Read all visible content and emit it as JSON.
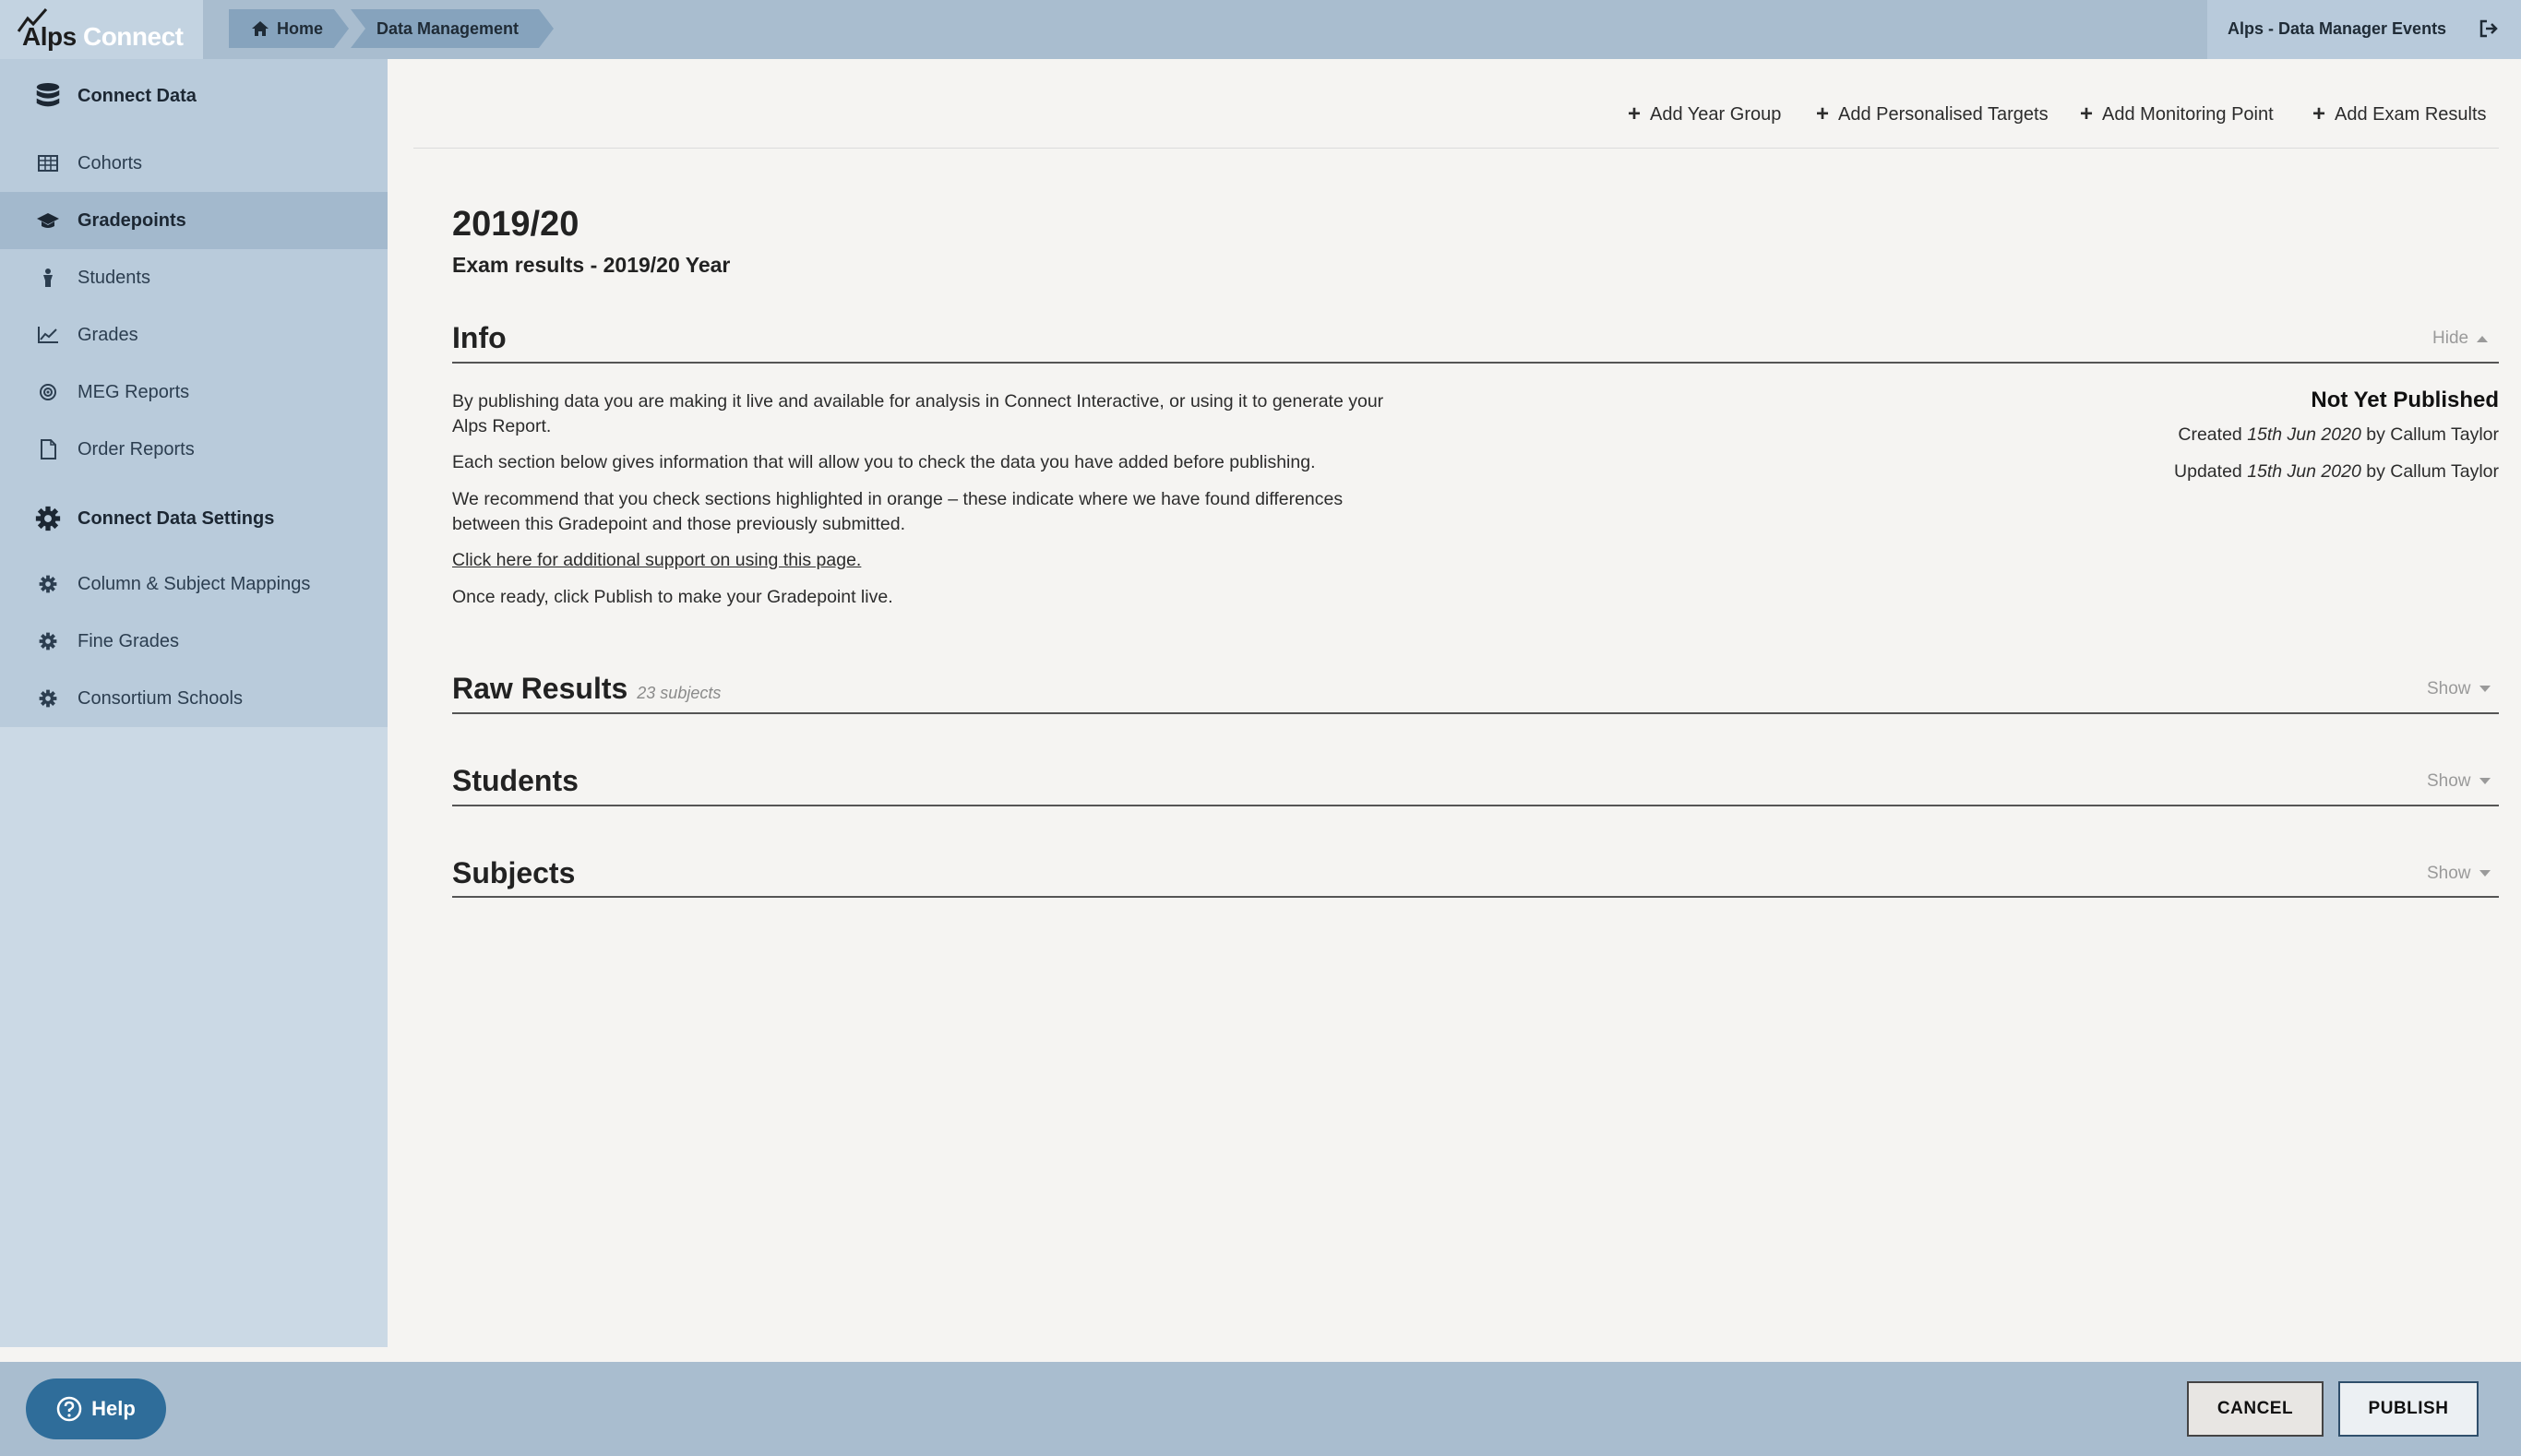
{
  "header": {
    "logo_primary": "Alps",
    "logo_secondary": "Connect",
    "breadcrumb": [
      "Home",
      "Data Management"
    ],
    "account_label": "Alps - Data Manager Events"
  },
  "sidebar": {
    "items": [
      {
        "label": "Connect Data",
        "icon": "database-icon"
      },
      {
        "label": "Cohorts",
        "icon": "table-icon"
      },
      {
        "label": "Gradepoints",
        "icon": "graduation-cap-icon",
        "active": true
      },
      {
        "label": "Students",
        "icon": "student-icon"
      },
      {
        "label": "Grades",
        "icon": "line-chart-icon"
      },
      {
        "label": "MEG Reports",
        "icon": "target-icon"
      },
      {
        "label": "Order Reports",
        "icon": "document-icon"
      },
      {
        "label": "Connect Data Settings",
        "icon": "gear-icon"
      },
      {
        "label": "Column & Subject Mappings",
        "icon": "gear-icon"
      },
      {
        "label": "Fine Grades",
        "icon": "gear-icon"
      },
      {
        "label": "Consortium Schools",
        "icon": "gear-icon"
      }
    ]
  },
  "toolbar": {
    "links": [
      "Add Year Group",
      "Add Personalised Targets",
      "Add Monitoring Point",
      "Add Exam Results"
    ]
  },
  "main": {
    "year": "2019/20",
    "subtitle": "Exam results - 2019/20 Year",
    "info": {
      "title": "Info",
      "toggle": "Hide",
      "paragraphs": [
        "By publishing data you are making it live and available for analysis in Connect Interactive, or using it to generate your Alps Report.",
        "Each section below gives information that will allow you to check the data you have added before publishing.",
        "We recommend that you check sections highlighted in orange – these indicate where we have found differences between this Gradepoint and those previously submitted."
      ],
      "support_link": "Click here for additional support on using this page.",
      "final_note": "Once ready, click Publish to make your Gradepoint live.",
      "status": "Not Yet Published",
      "created_prefix": "Created",
      "created_date": "15th Jun 2020",
      "created_by": "by Callum Taylor",
      "updated_prefix": "Updated",
      "updated_date": "15th Jun 2020",
      "updated_by": "by Callum Taylor"
    },
    "raw_results": {
      "title": "Raw Results",
      "count": "23 subjects",
      "toggle": "Show"
    },
    "students": {
      "title": "Students",
      "toggle": "Show"
    },
    "subjects": {
      "title": "Subjects",
      "toggle": "Show"
    }
  },
  "footer": {
    "help_label": "Help",
    "cancel_label": "CANCEL",
    "publish_label": "PUBLISH"
  },
  "colors": {
    "topbar": "#a9bdcf",
    "sidebar": "#cbd9e5",
    "sidebar_active": "#a3b9cd",
    "help_button": "#2f6d9a"
  }
}
